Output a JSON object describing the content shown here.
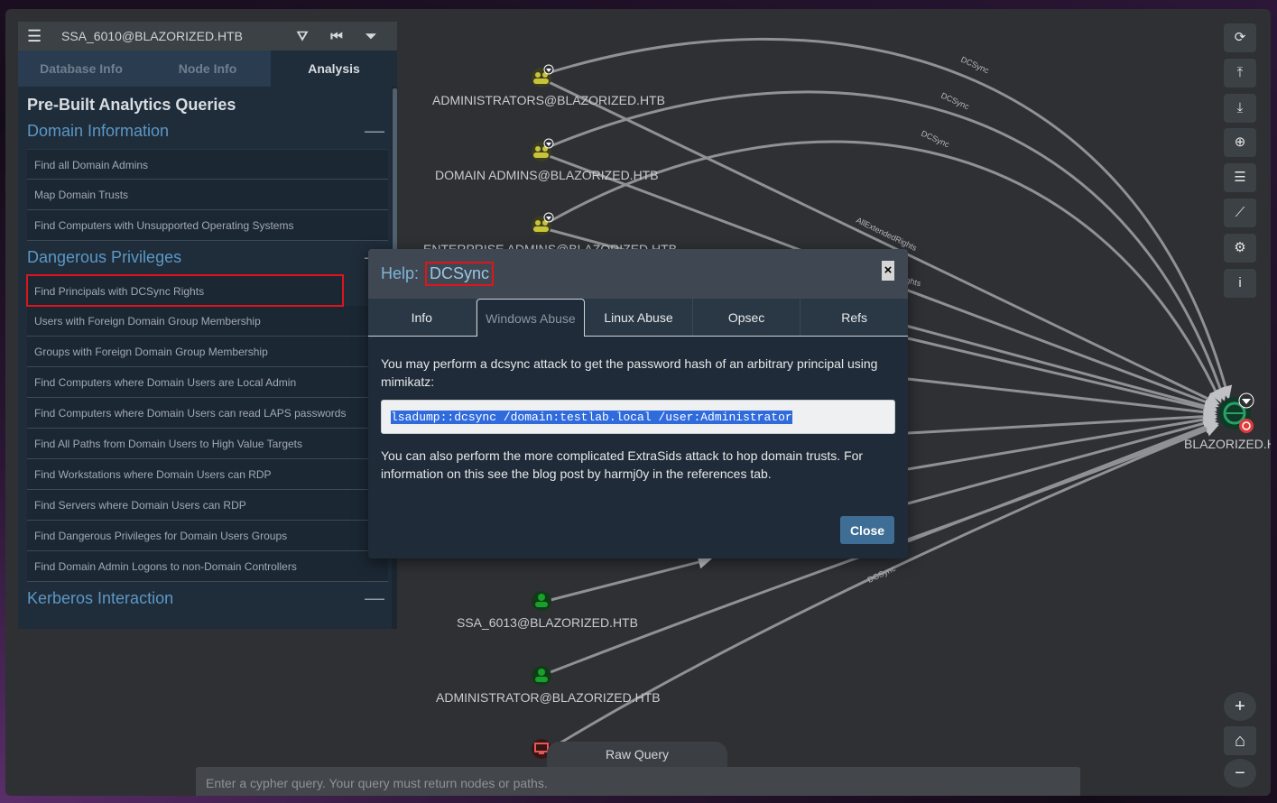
{
  "panel": {
    "header_user": "SSA_6010@BLAZORIZED.HTB",
    "tabs": [
      "Database Info",
      "Node Info",
      "Analysis"
    ],
    "prebuilt_title": "Pre-Built Analytics Queries",
    "sections": {
      "domain_info": "Domain Information",
      "dangerous": "Dangerous Privileges",
      "kerberos": "Kerberos Interaction"
    },
    "domain_queries": [
      "Find all Domain Admins",
      "Map Domain Trusts",
      "Find Computers with Unsupported Operating Systems"
    ],
    "dangerous_queries": [
      "Find Principals with DCSync Rights",
      "Users with Foreign Domain Group Membership",
      "Groups with Foreign Domain Group Membership",
      "Find Computers where Domain Users are Local Admin",
      "Find Computers where Domain Users can read LAPS passwords",
      "Find All Paths from Domain Users to High Value Targets",
      "Find Workstations where Domain Users can RDP",
      "Find Servers where Domain Users can RDP",
      "Find Dangerous Privileges for Domain Users Groups",
      "Find Domain Admin Logons to non-Domain Controllers"
    ],
    "collapse_symbol": "—"
  },
  "graph": {
    "nodes": {
      "administrators": "ADMINISTRATORS@BLAZORIZED.HTB",
      "domain_admins": "DOMAIN ADMINS@BLAZORIZED.HTB",
      "enterprise_admins": "ENTERPRISE ADMINS@BLAZORIZED.HTB",
      "ssa_6013": "SSA_6013@BLAZORIZED.HTB",
      "administrator": "ADMINISTRATOR@BLAZORIZED.HTB",
      "domain": "BLAZORIZED.HT"
    },
    "edge_labels": {
      "dcsync": "DCSync",
      "all_extended_rights": "AllExtendedRights",
      "partial_rights": "ghts"
    },
    "colors": {
      "group_node": "#c9c33a",
      "user_node": "#19a02c",
      "computer_node": "#e05a5a",
      "domain_node": "#2aa06a",
      "edge": "#8f9194"
    }
  },
  "toolbar": {
    "icons": [
      "refresh-icon",
      "upload-icon",
      "download-icon",
      "import-icon",
      "checklist-icon",
      "chart-icon",
      "settings-icon",
      "info-icon"
    ],
    "glyphs": [
      "⟳",
      "⤒",
      "⤓",
      "⊕",
      "☰",
      "⟋",
      "⚙",
      "i"
    ],
    "zoom": [
      "+",
      "⌂",
      "−"
    ]
  },
  "raw_query": {
    "label": "Raw Query",
    "placeholder": "Enter a cypher query. Your query must return nodes or paths."
  },
  "modal": {
    "title_prefix": "Help:",
    "edge": "DCSync",
    "close_x": "×",
    "tabs": [
      "Info",
      "Windows Abuse",
      "Linux Abuse",
      "Opsec",
      "Refs"
    ],
    "active_tab": "Windows Abuse",
    "para1": "You may perform a dcsync attack to get the password hash of an arbitrary principal using mimikatz:",
    "code": "lsadump::dcsync /domain:testlab.local /user:Administrator",
    "para2": "You can also perform the more complicated ExtraSids attack to hop domain trusts. For information on this see the blog post by harmj0y in the references tab.",
    "close_button": "Close"
  }
}
